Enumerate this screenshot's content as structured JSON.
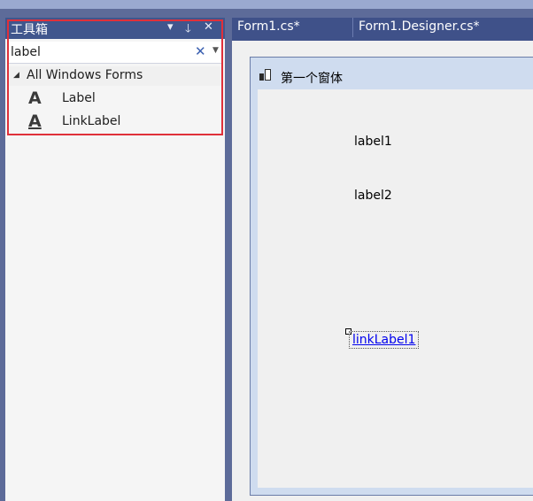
{
  "toolbox": {
    "title": "工具箱",
    "pin_glyph": "🡓",
    "close_glyph": "✕",
    "search": {
      "value": "label",
      "clear_glyph": "✕",
      "dropdown_glyph": "▼"
    },
    "group": {
      "expander_glyph": "◢",
      "label": "All Windows Forms"
    },
    "items": [
      {
        "icon_glyph": "A",
        "label": "Label"
      },
      {
        "icon_glyph": "A",
        "label": "LinkLabel"
      }
    ]
  },
  "editor": {
    "tabs": [
      {
        "label": "Form1.cs*"
      },
      {
        "label": "Form1.Designer.cs*"
      }
    ]
  },
  "form": {
    "title": "第一个窗体",
    "controls": {
      "label1": "label1",
      "label2": "label2",
      "linklabel1": "linkLabel1"
    }
  },
  "colors": {
    "panel_header": "#40568d",
    "tab_strip": "#3f5189",
    "highlight_border": "#e0303a",
    "link": "#0000ee"
  }
}
